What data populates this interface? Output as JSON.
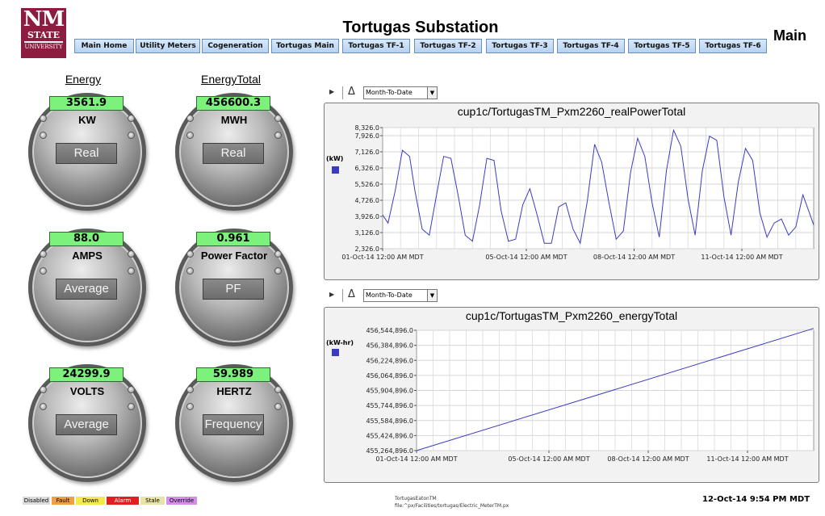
{
  "logo": {
    "line1": "NM",
    "line2": "STATE",
    "line3": "UNIVERSITY"
  },
  "header": {
    "title": "Tortugas Substation",
    "view": "Main"
  },
  "nav": [
    {
      "label": "Main Home"
    },
    {
      "label": "Utility Meters"
    },
    {
      "label": "Cogeneration"
    },
    {
      "label": "Tortugas Main"
    },
    {
      "label": "Tortugas TF-1"
    },
    {
      "label": "Tortugas TF-2"
    },
    {
      "label": "Tortugas TF-3"
    },
    {
      "label": "Tortugas TF-4"
    },
    {
      "label": "Tortugas TF-5"
    },
    {
      "label": "Tortugas TF-6"
    }
  ],
  "columns": {
    "left": "Energy",
    "right": "EnergyTotal"
  },
  "meters": [
    {
      "value": "3561.9",
      "unit": "KW",
      "plate": "Real"
    },
    {
      "value": "456600.3",
      "unit": "MWH",
      "plate": "Real"
    },
    {
      "value": "88.0",
      "unit": "AMPS",
      "plate": "Average"
    },
    {
      "value": "0.961",
      "unit": "Power Factor",
      "plate": "PF"
    },
    {
      "value": "24299.9",
      "unit": "VOLTS",
      "plate": "Average"
    },
    {
      "value": "59.989",
      "unit": "HERTZ",
      "plate": "Frequency"
    }
  ],
  "controls": [
    {
      "range": "Month-To-Date"
    },
    {
      "range": "Month-To-Date"
    }
  ],
  "chart_data": [
    {
      "type": "line",
      "title": "cup1c/TortugasTM_Pxm2260_realPowerTotal",
      "ylabel": "(kW)",
      "ylim": [
        2326,
        8326
      ],
      "yticks": [
        "2,326.0",
        "3,126.0",
        "3,926.0",
        "4,726.0",
        "5,526.0",
        "6,326.0",
        "7,126.0",
        "7,926.0",
        "8,326.0"
      ],
      "ytick_values": [
        2326,
        3126,
        3926,
        4726,
        5526,
        6326,
        7126,
        7926,
        8326
      ],
      "xlim": [
        0,
        12
      ],
      "xticks": [
        "01-Oct-14 12:00 AM MDT",
        "05-Oct-14 12:00 AM MDT",
        "08-Oct-14 12:00 AM MDT",
        "11-Oct-14 12:00 AM MDT"
      ],
      "xtick_values": [
        0,
        4,
        7,
        10
      ],
      "grid": true,
      "series": [
        {
          "color": "#3b3bc0",
          "x": [
            0,
            0.15,
            0.35,
            0.55,
            0.75,
            0.9,
            1.1,
            1.3,
            1.5,
            1.7,
            1.9,
            2.1,
            2.3,
            2.5,
            2.7,
            2.9,
            3.1,
            3.3,
            3.5,
            3.7,
            3.9,
            4.1,
            4.3,
            4.5,
            4.7,
            4.9,
            5.1,
            5.3,
            5.5,
            5.7,
            5.9,
            6.1,
            6.3,
            6.5,
            6.7,
            6.9,
            7.1,
            7.3,
            7.5,
            7.7,
            7.9,
            8.1,
            8.3,
            8.5,
            8.7,
            8.9,
            9.1,
            9.3,
            9.5,
            9.7,
            9.9,
            10.1,
            10.3,
            10.5,
            10.7,
            10.9,
            11.1,
            11.3,
            11.5,
            11.7,
            11.9,
            12
          ],
          "y": [
            4000,
            3600,
            5200,
            7200,
            6900,
            5200,
            3300,
            3000,
            5000,
            6900,
            6800,
            5000,
            3000,
            2700,
            4500,
            6800,
            6700,
            4200,
            2700,
            2800,
            4500,
            5300,
            4000,
            2600,
            2600,
            4400,
            4600,
            3300,
            2600,
            4700,
            7500,
            6600,
            4600,
            2800,
            3200,
            6100,
            7800,
            6900,
            4600,
            2900,
            6200,
            8200,
            7400,
            4800,
            3000,
            6200,
            7900,
            7700,
            4900,
            3000,
            5600,
            7300,
            6700,
            4100,
            2900,
            3600,
            3800,
            3000,
            3400,
            5000,
            4000,
            3500
          ]
        }
      ]
    },
    {
      "type": "line",
      "title": "cup1c/TortugasTM_Pxm2260_energyTotal",
      "ylabel": "(kW-hr)",
      "ylim": [
        455264896,
        456544896
      ],
      "yticks": [
        "455,264,896.0",
        "455,424,896.0",
        "455,584,896.0",
        "455,744,896.0",
        "455,904,896.0",
        "456,064,896.0",
        "456,224,896.0",
        "456,384,896.0",
        "456,544,896.0"
      ],
      "ytick_values": [
        455264896,
        455424896,
        455584896,
        455744896,
        455904896,
        456064896,
        456224896,
        456384896,
        456544896
      ],
      "xlim": [
        0,
        12
      ],
      "xticks": [
        "01-Oct-14 12:00 AM MDT",
        "05-Oct-14 12:00 AM MDT",
        "08-Oct-14 12:00 AM MDT",
        "11-Oct-14 12:00 AM MDT"
      ],
      "xtick_values": [
        0,
        4,
        7,
        10
      ],
      "grid": true,
      "series": [
        {
          "color": "#3b3bc0",
          "x": [
            0,
            12
          ],
          "y": [
            455264896,
            456564896
          ]
        }
      ]
    }
  ],
  "status_legend": [
    {
      "label": "Disabled",
      "bg": "#dcdcdc",
      "fg": "#000000"
    },
    {
      "label": "Fault",
      "bg": "#f0a040",
      "fg": "#000000"
    },
    {
      "label": "Down",
      "bg": "#f5e84a",
      "fg": "#000000"
    },
    {
      "label": "Alarm",
      "bg": "#e02020",
      "fg": "#ffffff"
    },
    {
      "label": "Stale",
      "bg": "#e8e4a8",
      "fg": "#000000"
    },
    {
      "label": "Override",
      "bg": "#d48ee8",
      "fg": "#000000"
    }
  ],
  "footer": {
    "name": "TortugasEatonTM",
    "path": "file:^px/Facilities/tortugas/Electric_MeterTM.px",
    "timestamp": "12-Oct-14 9:54 PM MDT"
  }
}
